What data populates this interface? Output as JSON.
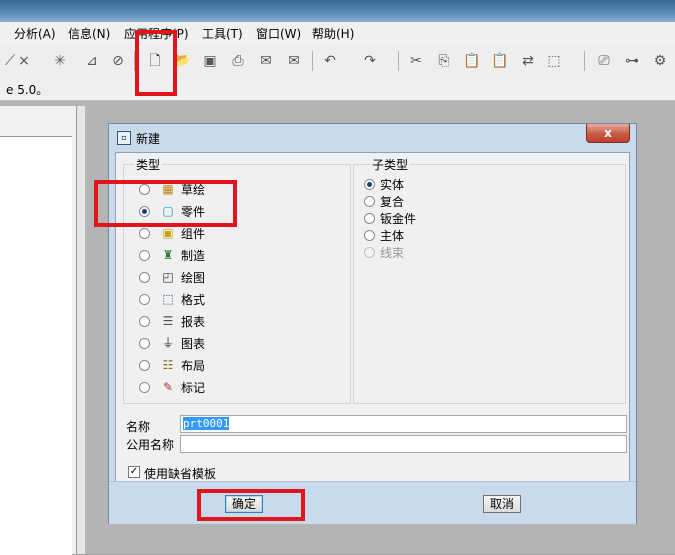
{
  "menu": [
    "分析(A)",
    "信息(N)",
    "应用程序(P)",
    "工具(T)",
    "窗口(W)",
    "帮助(H)"
  ],
  "status_text": "e 5.0。",
  "dialog": {
    "title": "新建",
    "close_label": "x",
    "type_group": {
      "label": "类型",
      "options": [
        {
          "label": "草绘",
          "icon": "sketch-icon",
          "selected": false
        },
        {
          "label": "零件",
          "icon": "part-icon",
          "selected": true
        },
        {
          "label": "组件",
          "icon": "assembly-icon",
          "selected": false
        },
        {
          "label": "制造",
          "icon": "manufacturing-icon",
          "selected": false
        },
        {
          "label": "绘图",
          "icon": "drawing-icon",
          "selected": false
        },
        {
          "label": "格式",
          "icon": "format-icon",
          "selected": false
        },
        {
          "label": "报表",
          "icon": "report-icon",
          "selected": false
        },
        {
          "label": "图表",
          "icon": "diagram-icon",
          "selected": false
        },
        {
          "label": "布局",
          "icon": "layout-icon",
          "selected": false
        },
        {
          "label": "标记",
          "icon": "markup-icon",
          "selected": false
        }
      ]
    },
    "subtype_group": {
      "label": "子类型",
      "options": [
        {
          "label": "实体",
          "selected": true,
          "disabled": false
        },
        {
          "label": "复合",
          "selected": false,
          "disabled": false
        },
        {
          "label": "钣金件",
          "selected": false,
          "disabled": false
        },
        {
          "label": "主体",
          "selected": false,
          "disabled": false
        },
        {
          "label": "线束",
          "selected": false,
          "disabled": true
        }
      ]
    },
    "name_label": "名称",
    "name_value": "prt0001",
    "common_name_label": "公用名称",
    "common_name_value": "",
    "use_default_template_label": "使用缺省模板",
    "use_default_template_checked": true,
    "ok_label": "确定",
    "cancel_label": "取消"
  },
  "colors": {
    "highlight": "#e0141c",
    "dialog_frame": "#c9daea",
    "selection": "#3399ff"
  }
}
